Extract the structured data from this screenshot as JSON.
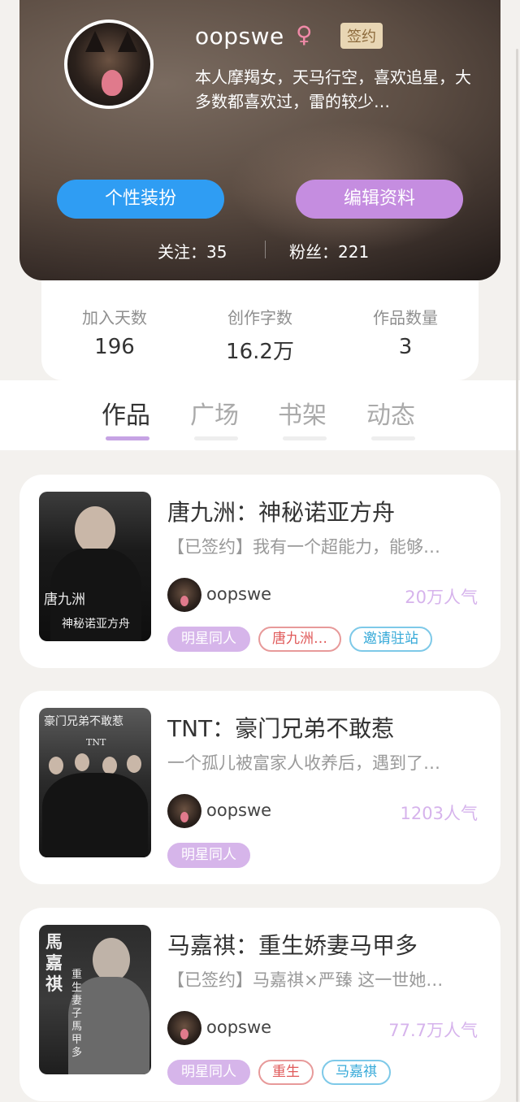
{
  "profile": {
    "username": "oopswe",
    "gender_symbol": "♀",
    "badge": "签约",
    "bio": "本人摩羯女，天马行空，喜欢追星，大多数都喜欢过，雷的较少…",
    "buttons": {
      "dress": "个性装扮",
      "edit": "编辑资料"
    },
    "follow": "关注：35",
    "fans": "粉丝：221"
  },
  "stats": [
    {
      "label": "加入天数",
      "value": "196"
    },
    {
      "label": "创作字数",
      "value": "16.2万"
    },
    {
      "label": "作品数量",
      "value": "3"
    }
  ],
  "tabs": [
    {
      "label": "作品",
      "active": true
    },
    {
      "label": "广场",
      "active": false
    },
    {
      "label": "书架",
      "active": false
    },
    {
      "label": "动态",
      "active": false
    }
  ],
  "works": [
    {
      "title": "唐九洲：神秘诺亚方舟",
      "description": "【已签约】我有一个超能力，能够…",
      "author": "oopswe",
      "popularity": "20万人气",
      "tags": [
        {
          "label": "明星同人",
          "style": "purple"
        },
        {
          "label": "唐九洲…",
          "style": "red"
        },
        {
          "label": "邀请驻站",
          "style": "blue"
        }
      ],
      "cover_text": [
        "唐九洲",
        "神秘诺亚方舟"
      ]
    },
    {
      "title": "TNT：豪门兄弟不敢惹",
      "description": "一个孤儿被富家人收养后，遇到了…",
      "author": "oopswe",
      "popularity": "1203人气",
      "tags": [
        {
          "label": "明星同人",
          "style": "purple"
        }
      ],
      "cover_text": [
        "豪门兄弟不敢惹",
        "TNT"
      ]
    },
    {
      "title": "马嘉祺：重生娇妻马甲多",
      "description": "【已签约】马嘉祺×严臻 这一世她…",
      "author": "oopswe",
      "popularity": "77.7万人气",
      "tags": [
        {
          "label": "明星同人",
          "style": "purple"
        },
        {
          "label": "重生",
          "style": "red"
        },
        {
          "label": "马嘉祺",
          "style": "blue"
        }
      ],
      "cover_text": [
        "馬嘉祺",
        "重生妻子馬甲多"
      ]
    }
  ],
  "colors": {
    "accent_purple": "#c58de0",
    "accent_blue": "#2f9df3",
    "popularity": "#d6b3ec"
  }
}
